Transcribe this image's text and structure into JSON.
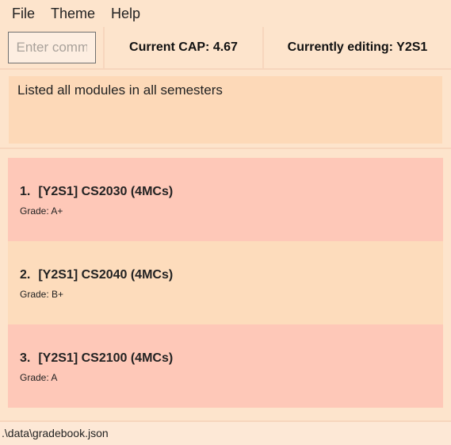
{
  "menu": {
    "items": [
      "File",
      "Theme",
      "Help"
    ]
  },
  "command": {
    "placeholder": "Enter command here..."
  },
  "cap": {
    "label": "Current CAP: 4.67"
  },
  "editing": {
    "label": "Currently editing: Y2S1"
  },
  "result": {
    "message": "Listed all modules in all semesters"
  },
  "modules": [
    {
      "index": "1.",
      "title": "[Y2S1] CS2030 (4MCs)",
      "grade": "Grade: A+"
    },
    {
      "index": "2.",
      "title": "[Y2S1] CS2040 (4MCs)",
      "grade": "Grade: B+"
    },
    {
      "index": "3.",
      "title": "[Y2S1] CS2100 (4MCs)",
      "grade": "Grade: A"
    }
  ],
  "status": {
    "file_path": ".\\data\\gradebook.json"
  },
  "colors": {
    "background": "#fde4cc",
    "card_odd": "#fec8b8",
    "card_even": "#fddcbc",
    "result_box": "#fdd9b8"
  }
}
